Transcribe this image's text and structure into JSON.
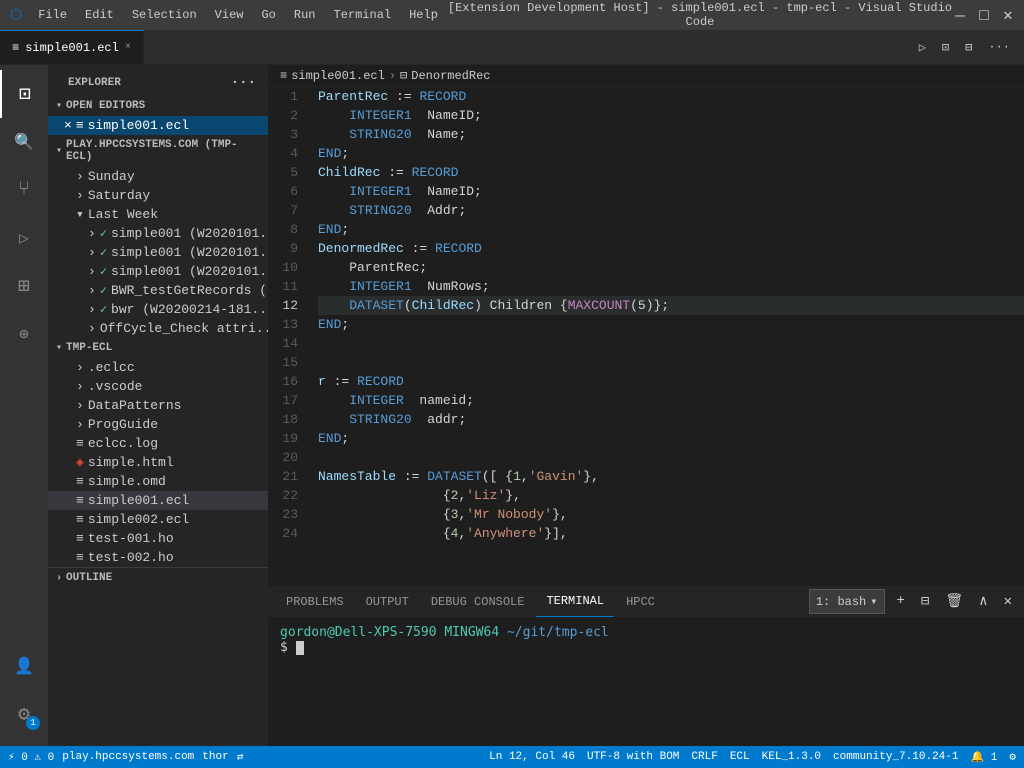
{
  "titleBar": {
    "title": "[Extension Development Host] - simple001.ecl - tmp-ecl - Visual Studio Code",
    "appIcon": "⬡",
    "menus": [
      "File",
      "Edit",
      "Selection",
      "View",
      "Go",
      "Run",
      "Terminal",
      "Help"
    ],
    "windowControls": [
      "—",
      "□",
      "✕"
    ]
  },
  "tabs": {
    "activeTab": {
      "icon": "≡",
      "label": "simple001.ecl",
      "isDirty": false,
      "closeIcon": "×"
    },
    "actions": [
      "▷",
      "⊡",
      "⊟",
      "···"
    ]
  },
  "breadcrumb": {
    "parts": [
      "simple001.ecl",
      "DenormedRec"
    ],
    "sep": "›",
    "icons": [
      "≡",
      "⊟"
    ]
  },
  "sidebar": {
    "title": "Explorer",
    "openEditors": {
      "label": "Open Editors",
      "items": [
        {
          "icon": "×",
          "fileIcon": "≡",
          "name": "simple001.ecl",
          "active": true
        }
      ]
    },
    "remoteSection": {
      "label": "PLAY.HPCCSYSTEMS.COM (TMP-ECL)",
      "items": [
        {
          "indent": 1,
          "label": "Sunday",
          "expandable": true
        },
        {
          "indent": 1,
          "label": "Saturday",
          "expandable": true
        },
        {
          "indent": 1,
          "label": "Last Week",
          "expandable": false,
          "expanded": true
        },
        {
          "indent": 2,
          "label": "simple001 (W2020101...",
          "statusIcon": "✓",
          "expandable": true
        },
        {
          "indent": 2,
          "label": "simple001 (W2020101...",
          "statusIcon": "✓",
          "expandable": true
        },
        {
          "indent": 2,
          "label": "simple001 (W2020101...",
          "statusIcon": "✓",
          "expandable": true
        },
        {
          "indent": 2,
          "label": "BWR_testGetRecords (...",
          "statusIcon": "✓",
          "expandable": true
        },
        {
          "indent": 2,
          "label": "bwr (W20200214-181...",
          "statusIcon": "✓",
          "expandable": true
        },
        {
          "indent": 2,
          "label": "OffCycle_Check attri...",
          "expandable": true
        }
      ]
    },
    "localSection": {
      "label": "TMP-ECL",
      "items": [
        {
          "indent": 1,
          "label": ".eclcc",
          "expandable": true
        },
        {
          "indent": 1,
          "label": ".vscode",
          "expandable": true
        },
        {
          "indent": 1,
          "label": "DataPatterns",
          "expandable": true
        },
        {
          "indent": 1,
          "label": "ProgGuide",
          "expandable": true
        },
        {
          "indent": 1,
          "label": "eclcc.log",
          "fileIcon": "≡",
          "isFile": true
        },
        {
          "indent": 1,
          "label": "simple.html",
          "fileIcon": "◈",
          "isFile": true,
          "isHtml": true
        },
        {
          "indent": 1,
          "label": "simple.omd",
          "fileIcon": "≡",
          "isFile": true
        },
        {
          "indent": 1,
          "label": "simple001.ecl",
          "fileIcon": "≡",
          "isFile": true,
          "active": true
        },
        {
          "indent": 1,
          "label": "simple002.ecl",
          "fileIcon": "≡",
          "isFile": true
        },
        {
          "indent": 1,
          "label": "test-001.ho",
          "fileIcon": "≡",
          "isFile": true
        },
        {
          "indent": 1,
          "label": "test-002.ho",
          "fileIcon": "≡",
          "isFile": true
        }
      ]
    },
    "outline": {
      "label": "Outline"
    }
  },
  "codeLines": [
    {
      "num": 1,
      "content": "ParentRec := RECORD",
      "tokens": [
        {
          "text": "ParentRec",
          "class": "ident"
        },
        {
          "text": " := ",
          "class": "op"
        },
        {
          "text": "RECORD",
          "class": "kw"
        }
      ]
    },
    {
      "num": 2,
      "content": "    INTEGER1  NameID;",
      "tokens": [
        {
          "text": "    ",
          "class": "plain"
        },
        {
          "text": "INTEGER1",
          "class": "kw"
        },
        {
          "text": "  NameID;",
          "class": "plain"
        }
      ]
    },
    {
      "num": 3,
      "content": "    STRING20  Name;",
      "tokens": [
        {
          "text": "    ",
          "class": "plain"
        },
        {
          "text": "STRING20",
          "class": "kw"
        },
        {
          "text": "  Name;",
          "class": "plain"
        }
      ]
    },
    {
      "num": 4,
      "content": "END;",
      "tokens": [
        {
          "text": "END",
          "class": "kw"
        },
        {
          "text": ";",
          "class": "plain"
        }
      ]
    },
    {
      "num": 5,
      "content": "ChildRec := RECORD",
      "tokens": [
        {
          "text": "ChildRec",
          "class": "ident"
        },
        {
          "text": " := ",
          "class": "op"
        },
        {
          "text": "RECORD",
          "class": "kw"
        }
      ]
    },
    {
      "num": 6,
      "content": "    INTEGER1  NameID;",
      "tokens": [
        {
          "text": "    ",
          "class": "plain"
        },
        {
          "text": "INTEGER1",
          "class": "kw"
        },
        {
          "text": "  NameID;",
          "class": "plain"
        }
      ]
    },
    {
      "num": 7,
      "content": "    STRING20  Addr;",
      "tokens": [
        {
          "text": "    ",
          "class": "plain"
        },
        {
          "text": "STRING20",
          "class": "kw"
        },
        {
          "text": "  Addr;",
          "class": "plain"
        }
      ]
    },
    {
      "num": 8,
      "content": "END;",
      "tokens": [
        {
          "text": "END",
          "class": "kw"
        },
        {
          "text": ";",
          "class": "plain"
        }
      ]
    },
    {
      "num": 9,
      "content": "DenormedRec := RECORD",
      "tokens": [
        {
          "text": "DenormedRec",
          "class": "ident"
        },
        {
          "text": " := ",
          "class": "op"
        },
        {
          "text": "RECORD",
          "class": "kw"
        }
      ]
    },
    {
      "num": 10,
      "content": "    ParentRec;",
      "tokens": [
        {
          "text": "    ParentRec;",
          "class": "plain"
        }
      ]
    },
    {
      "num": 11,
      "content": "    INTEGER1  NumRows;",
      "tokens": [
        {
          "text": "    ",
          "class": "plain"
        },
        {
          "text": "INTEGER1",
          "class": "kw"
        },
        {
          "text": "  NumRows;",
          "class": "plain"
        }
      ]
    },
    {
      "num": 12,
      "content": "    DATASET(ChildRec) Children {MAXCOUNT(5)};",
      "tokens": [
        {
          "text": "    ",
          "class": "plain"
        },
        {
          "text": "DATASET",
          "class": "kw"
        },
        {
          "text": "(",
          "class": "plain"
        },
        {
          "text": "ChildRec",
          "class": "ident"
        },
        {
          "text": ") Children {",
          "class": "plain"
        },
        {
          "text": "MAXCOUNT",
          "class": "attr"
        },
        {
          "text": "(5)};",
          "class": "plain"
        }
      ],
      "highlighted": true
    },
    {
      "num": 13,
      "content": "END;",
      "tokens": [
        {
          "text": "END",
          "class": "kw"
        },
        {
          "text": ";",
          "class": "plain"
        }
      ]
    },
    {
      "num": 14,
      "content": "",
      "tokens": []
    },
    {
      "num": 15,
      "content": "",
      "tokens": []
    },
    {
      "num": 16,
      "content": "r := RECORD",
      "tokens": [
        {
          "text": "r",
          "class": "ident"
        },
        {
          "text": " := ",
          "class": "op"
        },
        {
          "text": "RECORD",
          "class": "kw"
        }
      ]
    },
    {
      "num": 17,
      "content": "    INTEGER  nameid;",
      "tokens": [
        {
          "text": "    ",
          "class": "plain"
        },
        {
          "text": "INTEGER",
          "class": "kw"
        },
        {
          "text": "  nameid;",
          "class": "plain"
        }
      ]
    },
    {
      "num": 18,
      "content": "    STRING20  addr;",
      "tokens": [
        {
          "text": "    ",
          "class": "plain"
        },
        {
          "text": "STRING20",
          "class": "kw"
        },
        {
          "text": "  addr;",
          "class": "plain"
        }
      ]
    },
    {
      "num": 19,
      "content": "END;",
      "tokens": [
        {
          "text": "END",
          "class": "kw"
        },
        {
          "text": ";",
          "class": "plain"
        }
      ]
    },
    {
      "num": 20,
      "content": "",
      "tokens": []
    },
    {
      "num": 21,
      "content": "NamesTable := DATASET([ {1,'Gavin'},",
      "tokens": [
        {
          "text": "NamesTable",
          "class": "ident"
        },
        {
          "text": " := ",
          "class": "op"
        },
        {
          "text": "DATASET",
          "class": "kw"
        },
        {
          "text": "([ {",
          "class": "plain"
        },
        {
          "text": "1",
          "class": "num"
        },
        {
          "text": ",",
          "class": "plain"
        },
        {
          "text": "'Gavin'",
          "class": "str"
        },
        {
          "text": "},",
          "class": "plain"
        }
      ]
    },
    {
      "num": 22,
      "content": "                {2,'Liz'},",
      "tokens": [
        {
          "text": "                {",
          "class": "plain"
        },
        {
          "text": "2",
          "class": "num"
        },
        {
          "text": ",",
          "class": "plain"
        },
        {
          "text": "'Liz'",
          "class": "str"
        },
        {
          "text": "},",
          "class": "plain"
        }
      ]
    },
    {
      "num": 23,
      "content": "                {3,'Mr Nobody'},",
      "tokens": [
        {
          "text": "                {",
          "class": "plain"
        },
        {
          "text": "3",
          "class": "num"
        },
        {
          "text": ",",
          "class": "plain"
        },
        {
          "text": "'Mr Nobody'",
          "class": "str"
        },
        {
          "text": "},",
          "class": "plain"
        }
      ]
    },
    {
      "num": 24,
      "content": "                {4,'Anywhere'}],",
      "tokens": [
        {
          "text": "                {",
          "class": "plain"
        },
        {
          "text": "4",
          "class": "num"
        },
        {
          "text": ",",
          "class": "plain"
        },
        {
          "text": "'Anywhere'",
          "class": "str"
        },
        {
          "text": "}],",
          "class": "plain"
        }
      ]
    }
  ],
  "panel": {
    "tabs": [
      "PROBLEMS",
      "OUTPUT",
      "DEBUG CONSOLE",
      "TERMINAL",
      "HPCC"
    ],
    "activeTab": "TERMINAL",
    "terminal": {
      "shellLabel": "1: bash",
      "prompt": "gordon@Dell-XPS-7590 MINGW64",
      "path": "~/git/tmp-ecl",
      "command": ""
    }
  },
  "statusBar": {
    "left": [
      {
        "icon": "⚡",
        "text": "0"
      },
      {
        "icon": "⚠",
        "text": "0"
      }
    ],
    "serverText": "play.hpccsystems.com",
    "userText": "thor",
    "syncIcon": "⇄",
    "position": "Ln 12, Col 46",
    "encoding": "UTF-8 with BOM",
    "lineEnding": "CRLF",
    "language": "ECL",
    "version": "KEL_1.3.0",
    "community": "community_7.10.24-1",
    "notificationCount": "1",
    "settingsIcon": "⚙"
  },
  "activityBar": {
    "icons": [
      {
        "name": "explorer",
        "symbol": "⊡",
        "active": true
      },
      {
        "name": "search",
        "symbol": "🔍"
      },
      {
        "name": "source-control",
        "symbol": "⑂"
      },
      {
        "name": "run",
        "symbol": "▷"
      },
      {
        "name": "extensions",
        "symbol": "⊞"
      },
      {
        "name": "hpcc",
        "symbol": "⊕"
      }
    ],
    "bottomIcons": [
      {
        "name": "accounts",
        "symbol": "👤"
      },
      {
        "name": "settings",
        "symbol": "⚙"
      }
    ]
  }
}
